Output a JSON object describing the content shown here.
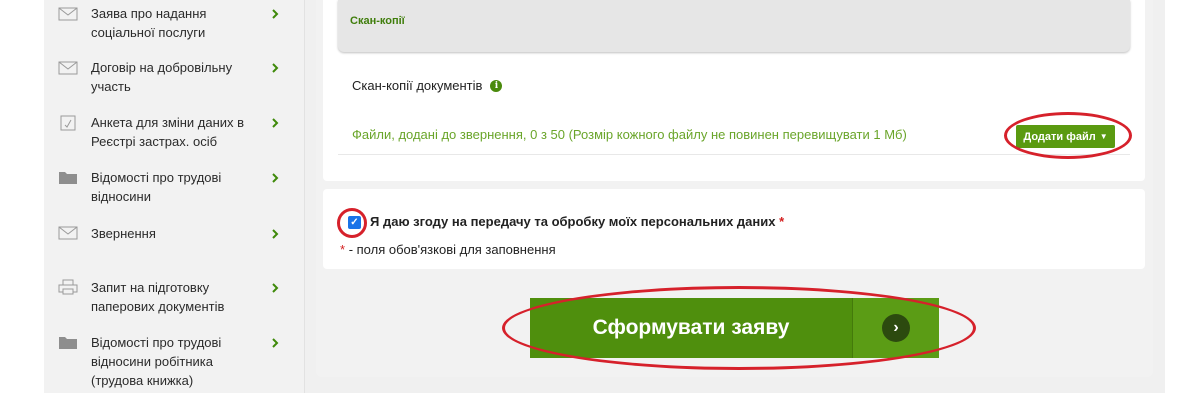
{
  "sidebar": {
    "items": [
      {
        "label": "Заява про надання соціальної послуги",
        "icon": "envelope-icon"
      },
      {
        "label": "Договір на добровільну участь",
        "icon": "envelope-icon"
      },
      {
        "label": "Анкета для зміни даних в Реєстрі застрах. осіб",
        "icon": "form-icon"
      },
      {
        "label": "Відомості про трудові відносини",
        "icon": "folder-icon"
      },
      {
        "label": "Звернення",
        "icon": "envelope-icon"
      },
      {
        "label": "Запит на підготовку паперових документів",
        "icon": "printer-icon"
      },
      {
        "label": "Відомості про трудові відносини робітника (трудова книжка)",
        "icon": "folder-icon"
      }
    ]
  },
  "scans": {
    "section_title": "Скан-копії",
    "documents_label": "Скан-копії документів",
    "files_info": "Файли, додані до звернення, 0 з 50 (Розмір кожного файлу не повинен перевищувати 1 Мб)",
    "add_file_label": "Додати файл"
  },
  "consent": {
    "checkbox_checked": true,
    "label": "Я даю згоду на передачу та обробку моїх персональних даних",
    "required_star": "*",
    "required_note": "- поля обов'язкові для заповнення"
  },
  "submit": {
    "label": "Сформувати заяву"
  },
  "colors": {
    "brand_green": "#4f8f0d",
    "light_green_text": "#6aa52a",
    "annotation_red": "#d6212b"
  }
}
